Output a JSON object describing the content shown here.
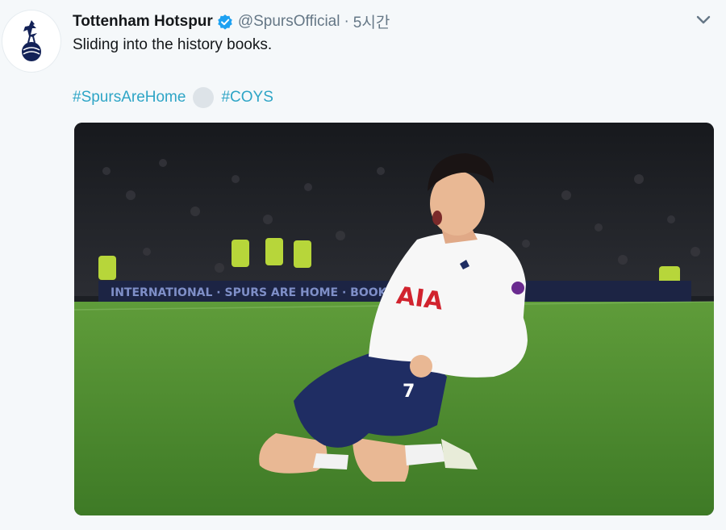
{
  "tweet": {
    "display_name": "Tottenham Hotspur",
    "handle": "@SpursOfficial",
    "separator": "·",
    "time_ago": "5시간",
    "text": "Sliding into the history books.",
    "hashtags": [
      "#SpursAreHome",
      "#COYS"
    ]
  },
  "media": {
    "board_text": "INTERNATIONAL  ·  SPURS ARE HOME  ·  BOOK NOW",
    "shirt_sponsor": "AIA",
    "shirt_number": "7"
  },
  "icons": {
    "avatar": "cockerel-crest-icon",
    "verified": "verified-badge-icon",
    "menu": "chevron-down-icon"
  },
  "colors": {
    "background": "#f5f8fa",
    "name": "#14171a",
    "muted": "#657786",
    "hashtag": "#2ea5c6",
    "verified": "#1da1f2",
    "pitch": "#4f8f2f",
    "kit_navy": "#1c2b5a"
  }
}
